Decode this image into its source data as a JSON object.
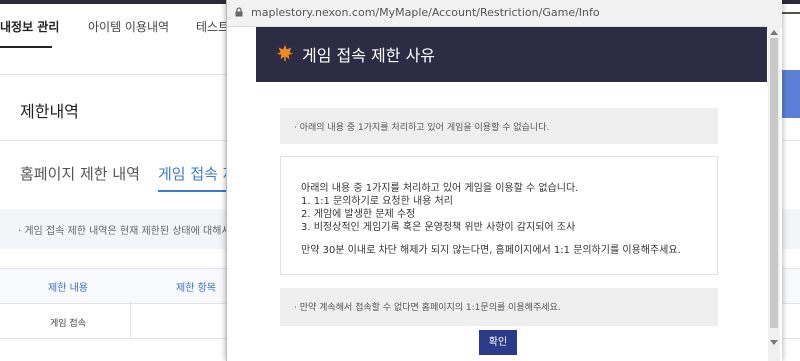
{
  "nav": {
    "tabs": [
      "내정보 관리",
      "아이템 이용내역",
      "테스트"
    ]
  },
  "page": {
    "section_title": "제한내역",
    "sub_tabs": [
      "홈페이지 제한 내역",
      "게임 접속 제"
    ],
    "info_text": "· 게임 접속 제한 내역은 현재 제한된 상태에 대해서만",
    "table": {
      "headers": [
        "제한 내용",
        "제한 항목"
      ],
      "rows": [
        [
          "게임 접속"
        ]
      ]
    }
  },
  "popup": {
    "url": "maplestory.nexon.com/MyMaple/Account/Restriction/Game/Info",
    "title": "게임 접속 제한 사유",
    "notice_top": "· 아래의 내용 중 1가지를 처리하고 있어 게임을 이용할 수 없습니다.",
    "detail_lines": [
      "아래의 내용 중 1가지를 처리하고 있어 게임을 이용할 수 없습니다.",
      "1. 1:1 문의하기로 요청한 내용 처리",
      "2. 게임에 발생한 문제 수정",
      "3. 비정상적인 게임기록 혹은 운영정책 위반 사항이 감지되어 조사",
      "만약 30분 이내로 차단 해제가 되지 않는다면, 홈페이지에서 1:1 문의하기를 이용해주세요."
    ],
    "notice_bottom": "· 만약 계속해서 접속할 수 없다면 홈페이지의 1:1문의를 이용해주세요.",
    "ok_label": "확인"
  },
  "colors": {
    "header_bg": "#2c2c44",
    "accent": "#3a7bd5",
    "button": "#2c3a8a",
    "leaf": "#f28a1f"
  }
}
